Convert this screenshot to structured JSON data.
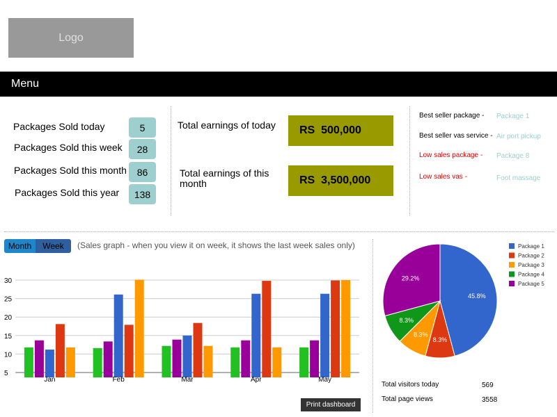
{
  "header": {
    "logo_text": "Logo"
  },
  "menu": {
    "label": "Menu"
  },
  "stats": [
    {
      "label": "Packages Sold today",
      "value": "5"
    },
    {
      "label": "Packages Sold this week",
      "value": "28"
    },
    {
      "label": "Packages Sold this month",
      "value": "86"
    },
    {
      "label": "Packages Sold this year",
      "value": "138"
    }
  ],
  "earnings": {
    "today_label": "Total earnings of today",
    "today_value": "RS  500,000",
    "month_label": "Total earnings of this month",
    "month_value": "RS  3,500,000"
  },
  "best": [
    {
      "label": "Best seller package -",
      "value": "Package 1",
      "low": false
    },
    {
      "label": "Best seller vas service -",
      "value": "Air port pickup",
      "low": false
    },
    {
      "label": "Low sales package -",
      "value": "Package 8",
      "low": true
    },
    {
      "label": "Low sales vas -",
      "value": "Foot massage",
      "low": true
    }
  ],
  "graph": {
    "tab_month": "Month",
    "tab_week": "Week",
    "note": "(Sales graph - when you view it on week, it shows the last week sales only)"
  },
  "colors": {
    "package1": "#3366cc",
    "package2": "#dc3912",
    "package3": "#ff9900",
    "package4": "#109618",
    "package5": "#990099",
    "earnings_box": "#999900",
    "stat_box": "#9dcfcf"
  },
  "chart_data": [
    {
      "type": "bar",
      "categories": [
        "Jan",
        "Feb",
        "Mar",
        "Apr",
        "May"
      ],
      "ylim": [
        5,
        30
      ],
      "yticks": [
        5,
        10,
        15,
        20,
        25,
        30
      ],
      "series": [
        {
          "color": "#22c022",
          "values": [
            11.8,
            11.6,
            12.2,
            11.8,
            11.8
          ]
        },
        {
          "color": "#990099",
          "values": [
            13.7,
            13.4,
            13.9,
            13.7,
            13.7
          ]
        },
        {
          "color": "#3366cc",
          "values": [
            11.2,
            26.1,
            15.0,
            26.3,
            26.3
          ]
        },
        {
          "color": "#dc3912",
          "values": [
            18.1,
            17.9,
            18.4,
            29.8,
            29.9
          ]
        },
        {
          "color": "#ff9900",
          "values": [
            11.8,
            30.1,
            12.2,
            11.8,
            30.0
          ]
        }
      ]
    },
    {
      "type": "pie",
      "labels": [
        "Package 1",
        "Package 2",
        "Package 3",
        "Package 4",
        "Package 5"
      ],
      "values": [
        45.8,
        8.3,
        8.3,
        8.3,
        29.2
      ],
      "slice_labels": [
        "45.8%",
        "8.3%",
        "8.3%",
        "8.3%",
        "29.2%"
      ],
      "colors": [
        "#3366cc",
        "#dc3912",
        "#ff9900",
        "#109618",
        "#990099"
      ],
      "legend": "right"
    }
  ],
  "visitors": [
    {
      "label": "Total visitors today",
      "value": "569"
    },
    {
      "label": "Total page views",
      "value": "3558"
    }
  ],
  "print_label": "Print dashboard"
}
